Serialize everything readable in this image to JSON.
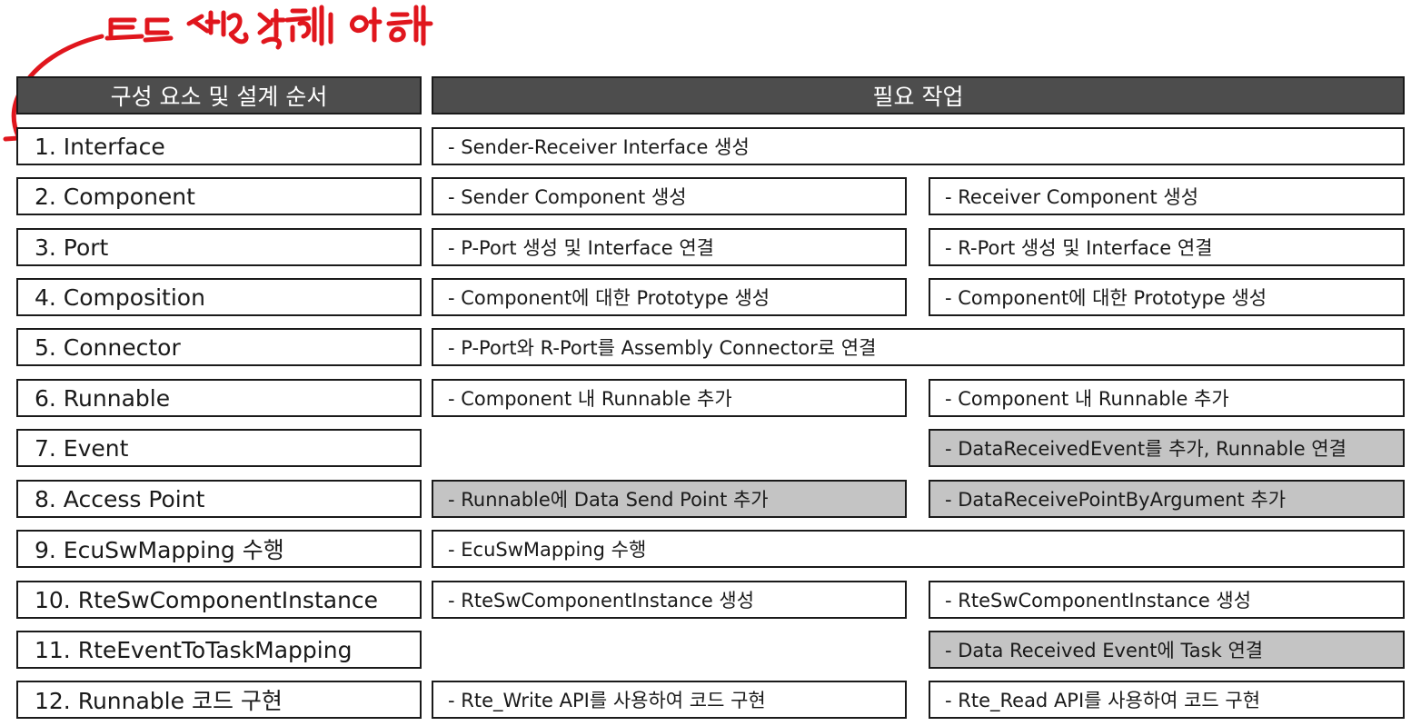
{
  "annotation": {
    "handwritten_text": "코드 생성에 위해"
  },
  "headers": {
    "left": "구성 요소 및 설계 순서",
    "right": "필요 작업"
  },
  "rows": [
    {
      "component": "1. Interface",
      "full": "- Sender-Receiver Interface 생성"
    },
    {
      "component": "2. Component",
      "sender": "- Sender Component 생성",
      "receiver": "- Receiver Component 생성"
    },
    {
      "component": "3. Port",
      "sender": "- P-Port 생성 및 Interface 연결",
      "receiver": "- R-Port 생성 및 Interface 연결"
    },
    {
      "component": "4. Composition",
      "sender": "- Component에 대한 Prototype 생성",
      "receiver": "- Component에 대한 Prototype 생성"
    },
    {
      "component": "5. Connector",
      "full": "- P-Port와 R-Port를 Assembly Connector로 연결"
    },
    {
      "component": "6. Runnable",
      "sender": "- Component 내 Runnable 추가",
      "receiver": "- Component 내 Runnable 추가"
    },
    {
      "component": "7. Event",
      "receiver": "- DataReceivedEvent를 추가, Runnable 연결"
    },
    {
      "component": "8. Access Point",
      "sender": "- Runnable에 Data Send Point 추가",
      "receiver": "- DataReceivePointByArgument 추가"
    },
    {
      "component": "9. EcuSwMapping 수행",
      "full": "- EcuSwMapping 수행"
    },
    {
      "component": "10. RteSwComponentInstance",
      "sender": "- RteSwComponentInstance 생성",
      "receiver": "- RteSwComponentInstance 생성"
    },
    {
      "component": "11. RteEventToTaskMapping",
      "receiver": "- Data Received Event에 Task 연결"
    },
    {
      "component": "12. Runnable 코드 구현",
      "sender": "- Rte_Write API를 사용하여 코드 구현",
      "receiver": "- Rte_Read API를 사용하여 코드 구현"
    }
  ],
  "colors": {
    "header_bg": "#4d4d4d",
    "header_text": "#ffffff",
    "border": "#1a1a1a",
    "highlight_bg": "#c4c4c4",
    "annotation_ink": "#e0161d"
  }
}
